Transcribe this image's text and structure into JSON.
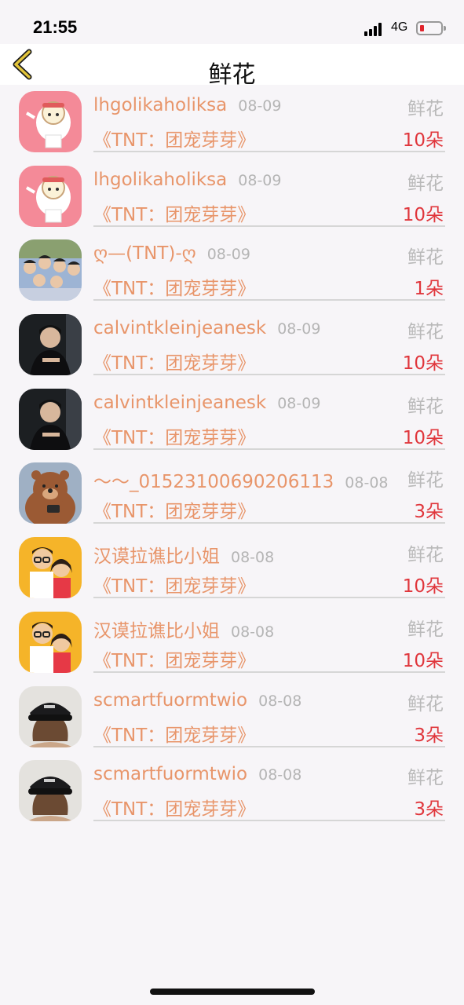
{
  "status": {
    "time": "21:55",
    "network": "4G"
  },
  "header": {
    "title": "鲜花"
  },
  "rows": [
    {
      "name": "lhgolikaholiksa",
      "date": "08-09",
      "label": "鲜花",
      "project": "《TNT：团宠芽芽》",
      "count": "10朵",
      "avatar": "sheep-avatar-icon"
    },
    {
      "name": "lhgolikaholiksa",
      "date": "08-09",
      "label": "鲜花",
      "project": "《TNT：团宠芽芽》",
      "count": "10朵",
      "avatar": "sheep-avatar-icon"
    },
    {
      "name": "ღ—(TNT)-ღ",
      "date": "08-09",
      "label": "鲜花",
      "project": "《TNT：团宠芽芽》",
      "count": "1朵",
      "avatar": "group-photo-avatar-icon"
    },
    {
      "name": "calvintkleinjeanesk",
      "date": "08-09",
      "label": "鲜花",
      "project": "《TNT：团宠芽芽》",
      "count": "10朵",
      "avatar": "man-photo-avatar-icon"
    },
    {
      "name": "calvintkleinjeanesk",
      "date": "08-09",
      "label": "鲜花",
      "project": "《TNT：团宠芽芽》",
      "count": "10朵",
      "avatar": "man-photo-avatar-icon"
    },
    {
      "name": "～～_01523100690206113",
      "date": "08-08",
      "label": "鲜花",
      "project": "《TNT：团宠芽芽》",
      "count": "3朵",
      "avatar": "bear-avatar-icon"
    },
    {
      "name": "汉谟拉谯比小姐",
      "date": "08-08",
      "label": "鲜花",
      "project": "《TNT：团宠芽芽》",
      "count": "10朵",
      "avatar": "cartoon-couple-avatar-icon"
    },
    {
      "name": "汉谟拉谯比小姐",
      "date": "08-08",
      "label": "鲜花",
      "project": "《TNT：团宠芽芽》",
      "count": "10朵",
      "avatar": "cartoon-couple-avatar-icon"
    },
    {
      "name": "scmartfuormtwio",
      "date": "08-08",
      "label": "鲜花",
      "project": "《TNT：团宠芽芽》",
      "count": "3朵",
      "avatar": "cap-girl-avatar-icon"
    },
    {
      "name": "scmartfuormtwio",
      "date": "08-08",
      "label": "鲜花",
      "project": "《TNT：团宠芽芽》",
      "count": "3朵",
      "avatar": "cap-girl-avatar-icon"
    }
  ],
  "colors": {
    "name": "#e8956a",
    "count": "#e0363c",
    "muted": "#b5b5b5",
    "background": "#f7f5f8",
    "back_arrow": "#c9a41a"
  }
}
